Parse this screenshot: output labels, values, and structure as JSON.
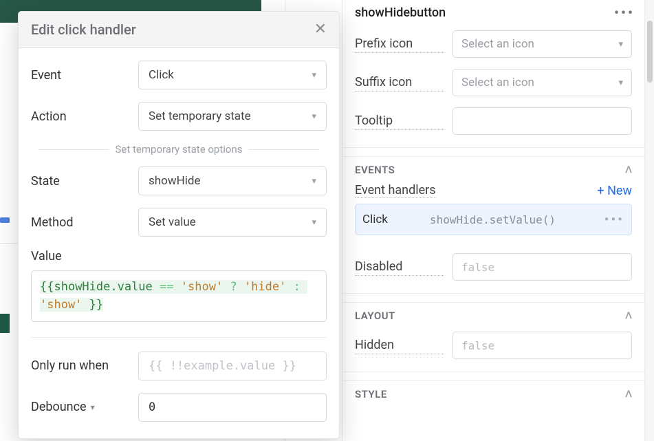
{
  "inspector": {
    "component_name": "showHidebutton",
    "props": {
      "prefix_icon_label": "Prefix icon",
      "prefix_icon_placeholder": "Select an icon",
      "suffix_icon_label": "Suffix icon",
      "suffix_icon_placeholder": "Select an icon",
      "tooltip_label": "Tooltip",
      "disabled_label": "Disabled",
      "disabled_placeholder": "false",
      "hidden_label": "Hidden",
      "hidden_placeholder": "false"
    },
    "sections": {
      "events": "EVENTS",
      "layout": "LAYOUT",
      "style": "STYLE"
    },
    "event_handlers_label": "Event handlers",
    "new_label": "+ New",
    "handlers": [
      {
        "event": "Click",
        "call": "showHide.setValue()"
      }
    ]
  },
  "modal": {
    "title": "Edit click handler",
    "fields": {
      "event_label": "Event",
      "event_value": "Click",
      "action_label": "Action",
      "action_value": "Set temporary state",
      "options_divider": "Set temporary state options",
      "state_label": "State",
      "state_value": "showHide",
      "method_label": "Method",
      "method_value": "Set value",
      "value_label": "Value",
      "value_code": "{{showHide.value == 'show' ? 'hide' : 'show' }}",
      "only_run_label": "Only run when",
      "only_run_placeholder": "{{ !!example.value }}",
      "debounce_label": "Debounce",
      "debounce_value": "0"
    }
  }
}
